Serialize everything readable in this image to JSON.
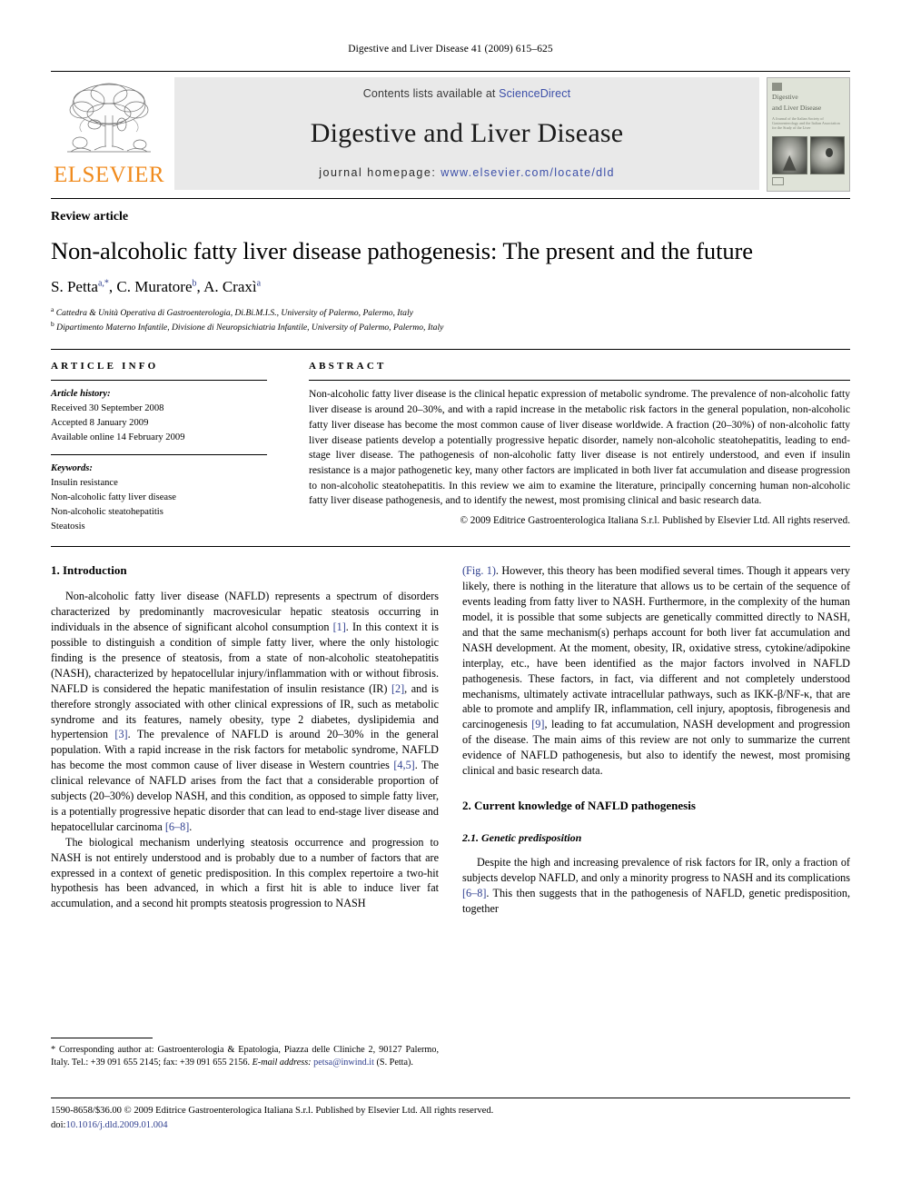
{
  "running_head": "Digestive and Liver Disease 41 (2009) 615–625",
  "header": {
    "contents_prefix": "Contents lists available at ",
    "sciencedirect": "ScienceDirect",
    "journal_title": "Digestive and Liver Disease",
    "homepage_prefix": "journal homepage:",
    "homepage_url": "www.elsevier.com/locate/dld",
    "publisher_wordmark": "ELSEVIER",
    "cover": {
      "title_line1": "Digestive",
      "title_line2": "and Liver Disease",
      "subtitle": "A Journal of the Italian Society of Gastroenterology and the Italian Association for the Study of the Liver"
    }
  },
  "article": {
    "type": "Review article",
    "title": "Non-alcoholic fatty liver disease pathogenesis: The present and the future",
    "authors": [
      {
        "name": "S. Petta",
        "sup": "a,*"
      },
      {
        "name": "C. Muratore",
        "sup": "b"
      },
      {
        "name": "A. Craxì",
        "sup": "a"
      }
    ],
    "affiliations": [
      {
        "marker": "a",
        "text": "Cattedra & Unità Operativa di Gastroenterologia, Di.Bi.M.I.S., University of Palermo, Palermo, Italy"
      },
      {
        "marker": "b",
        "text": "Dipartimento Materno Infantile, Divisione di Neuropsichiatria Infantile, University of Palermo, Palermo, Italy"
      }
    ]
  },
  "info": {
    "heading": "ARTICLE INFO",
    "history_label": "Article history:",
    "history": [
      "Received 30 September 2008",
      "Accepted 8 January 2009",
      "Available online 14 February 2009"
    ],
    "keywords_label": "Keywords:",
    "keywords": [
      "Insulin resistance",
      "Non-alcoholic fatty liver disease",
      "Non-alcoholic steatohepatitis",
      "Steatosis"
    ]
  },
  "abstract": {
    "heading": "ABSTRACT",
    "text": "Non-alcoholic fatty liver disease is the clinical hepatic expression of metabolic syndrome. The prevalence of non-alcoholic fatty liver disease is around 20–30%, and with a rapid increase in the metabolic risk factors in the general population, non-alcoholic fatty liver disease has become the most common cause of liver disease worldwide. A fraction (20–30%) of non-alcoholic fatty liver disease patients develop a potentially progressive hepatic disorder, namely non-alcoholic steatohepatitis, leading to end-stage liver disease. The pathogenesis of non-alcoholic fatty liver disease is not entirely understood, and even if insulin resistance is a major pathogenetic key, many other factors are implicated in both liver fat accumulation and disease progression to non-alcoholic steatohepatitis. In this review we aim to examine the literature, principally concerning human non-alcoholic fatty liver disease pathogenesis, and to identify the newest, most promising clinical and basic research data.",
    "copyright": "© 2009 Editrice Gastroenterologica Italiana S.r.l. Published by Elsevier Ltd. All rights reserved."
  },
  "body": {
    "section1_heading": "1.  Introduction",
    "p1_a": "Non-alcoholic fatty liver disease (NAFLD) represents a spectrum of disorders characterized by predominantly macrovesicular hepatic steatosis occurring in individuals in the absence of significant alcohol consumption ",
    "p1_ref1": "[1]",
    "p1_b": ". In this context it is possible to distinguish a condition of simple fatty liver, where the only histologic finding is the presence of steatosis, from a state of non-alcoholic steatohepatitis (NASH), characterized by hepatocellular injury/inflammation with or without fibrosis. NAFLD is considered the hepatic manifestation of insulin resistance (IR) ",
    "p1_ref2": "[2]",
    "p1_c": ", and is therefore strongly associated with other clinical expressions of IR, such as metabolic syndrome and its features, namely obesity, type 2 diabetes, dyslipidemia and hypertension ",
    "p1_ref3": "[3]",
    "p1_d": ". The prevalence of NAFLD is around 20–30% in the general population. With a rapid increase in the risk factors for metabolic syndrome, NAFLD has become the most common cause of liver disease in Western countries ",
    "p1_ref4": "[4,5]",
    "p1_e": ". The clinical relevance of NAFLD arises from the fact that a considerable proportion of subjects (20–30%) develop NASH, and this condition, as opposed to simple fatty liver, is a potentially progressive hepatic disorder that can lead to end-stage liver disease and hepatocellular carcinoma ",
    "p1_ref5": "[6–8]",
    "p1_f": ".",
    "p2": "The biological mechanism underlying steatosis occurrence and progression to NASH is not entirely understood and is probably due to a number of factors that are expressed in a context of genetic predisposition. In this complex repertoire a two-hit hypothesis has been advanced, in which a first hit is able to induce liver fat accumulation, and a second hit prompts steatosis progression to NASH ",
    "p2_figref": "(Fig. 1)",
    "p2_b": ". However, this theory has been modified several times. Though it appears very likely, there is nothing in the literature that allows us to be certain of the sequence of events leading from fatty liver to NASH. Furthermore, in the complexity of the human model, it is possible that some subjects are genetically committed directly to NASH, and that the same mechanism(s) perhaps account for both liver fat accumulation and NASH development. At the moment, obesity, IR, oxidative stress, cytokine/adipokine interplay, etc., have been identified as the major factors involved in NAFLD pathogenesis. These factors, in fact, via different and not completely understood mechanisms, ultimately activate intracellular pathways, such as IKK-β/NF-κ, that are able to promote and amplify IR, inflammation, cell injury, apoptosis, fibrogenesis and carcinogenesis ",
    "p2_ref9": "[9]",
    "p2_c": ", leading to fat accumulation, NASH development and progression of the disease. The main aims of this review are not only to summarize the current evidence of NAFLD pathogenesis, but also to identify the newest, most promising clinical and basic research data.",
    "section2_heading": "2.  Current knowledge of NAFLD pathogenesis",
    "subsection21_heading": "2.1.  Genetic predisposition",
    "p3_a": "Despite the high and increasing prevalence of risk factors for IR, only a fraction of subjects develop NAFLD, and only a minority progress to NASH and its complications ",
    "p3_ref": "[6–8]",
    "p3_b": ". This then suggests that in the pathogenesis of NAFLD, genetic predisposition, together"
  },
  "footnote": {
    "star": "*",
    "text_a": " Corresponding author at: Gastroenterologia & Epatologia, Piazza delle Cliniche 2, 90127 Palermo, Italy. Tel.: +39 091 655 2145; fax: +39 091 655 2156.",
    "email_label": "E-mail address:",
    "email": "petsa@inwind.it",
    "email_suffix": " (S. Petta)."
  },
  "footer": {
    "line1": "1590-8658/$36.00 © 2009 Editrice Gastroenterologica Italiana S.r.l. Published by Elsevier Ltd. All rights reserved.",
    "doi_label": "doi:",
    "doi": "10.1016/j.dld.2009.01.004"
  },
  "colors": {
    "link": "#2f3f8f",
    "elsevier_orange": "#f08a1c",
    "banner_bg": "#e9e9e9"
  }
}
